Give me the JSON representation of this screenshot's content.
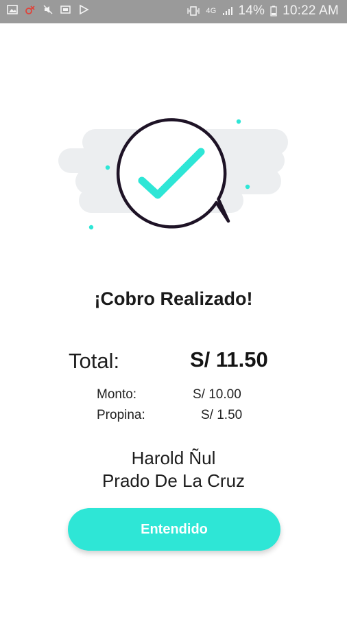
{
  "status_bar": {
    "battery": "14%",
    "time": "10:22 AM",
    "network": "4G",
    "icons": [
      "image-icon",
      "alarm-icon",
      "mute-icon",
      "sim-icon",
      "play-store-icon",
      "vibrate-icon",
      "signal-icon",
      "battery-icon"
    ]
  },
  "illustration": {
    "icon": "check-speech-bubble-icon",
    "colors": {
      "accent": "#2ee6d6",
      "outline": "#1e1326",
      "cloud": "#eceef0"
    }
  },
  "receipt": {
    "title": "¡Cobro Realizado!",
    "total_label": "Total:",
    "total_value": "S/ 11.50",
    "amount_label": "Monto:",
    "amount_value": "S/ 10.00",
    "tip_label": "Propina:",
    "tip_value": "S/ 1.50",
    "name_line1": "Harold Ñul",
    "name_line2": "Prado De La Cruz"
  },
  "actions": {
    "ok_label": "Entendido"
  },
  "colors": {
    "button": "#2ee6d6",
    "status_bar": "#9a9a9a"
  }
}
